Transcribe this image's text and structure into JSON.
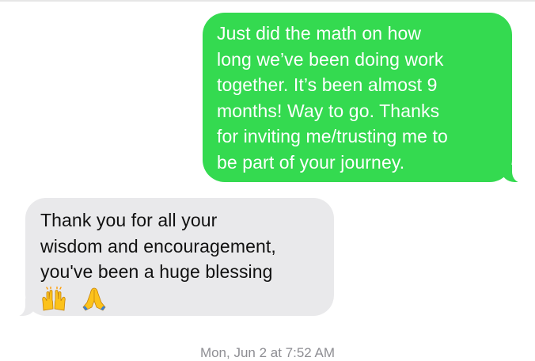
{
  "messages": [
    {
      "direction": "sent",
      "text": "Just did the math on how\nlong we’ve been doing work\ntogether. It’s been almost 9\nmonths! Way to go. Thanks\nfor inviting me/trusting me to\nbe part of your journey."
    },
    {
      "direction": "received",
      "text": "Thank you for all your\nwisdom and encouragement,\nyou've been a huge blessing",
      "emojis": [
        "raising-hands-emoji",
        "folded-hands-emoji"
      ]
    }
  ],
  "timestamp": "Mon, Jun 2 at 7:52 AM",
  "colors": {
    "sent_bubble": "#34da50",
    "received_bubble": "#e9e9eb",
    "timestamp_text": "#8e8e93",
    "background": "#ffffff"
  }
}
